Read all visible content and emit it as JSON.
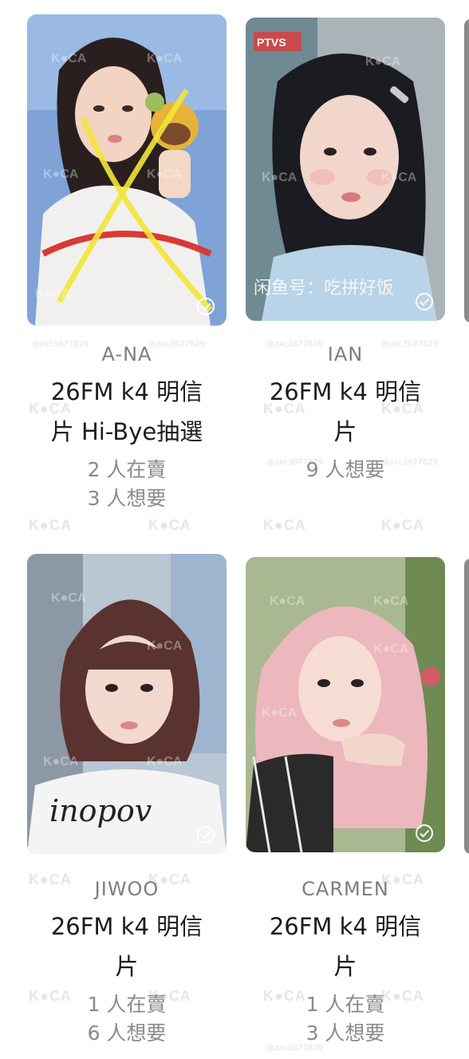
{
  "watermark": {
    "brand": "K●CA",
    "handle": "@zxc3677829",
    "overlay_text": "闲鱼号：吃拼好饭"
  },
  "cards": [
    {
      "member": "A-NA",
      "title_line1": "26FM k4 明信",
      "title_line2": "片 Hi-Bye抽選",
      "stat1": "2 人在賣",
      "stat2": "3 人想要",
      "collected": true,
      "crossed_out": true
    },
    {
      "member": "IAN",
      "title_line1": "26FM k4 明信",
      "title_line2": "片",
      "stat1": "9 人想要",
      "stat2": "",
      "collected": true,
      "crossed_out": false
    },
    {
      "member": "JIWOO",
      "title_line1": "26FM k4 明信",
      "title_line2": "片",
      "stat1": "1 人在賣",
      "stat2": "6 人想要",
      "collected": true,
      "crossed_out": false
    },
    {
      "member": "CARMEN",
      "title_line1": "26FM k4 明信",
      "title_line2": "片",
      "stat1": "1 人在賣",
      "stat2": "3 人想要",
      "collected": true,
      "crossed_out": false
    }
  ],
  "colors": {
    "check": "#ffffff",
    "cross_mark": "#f2e534"
  }
}
